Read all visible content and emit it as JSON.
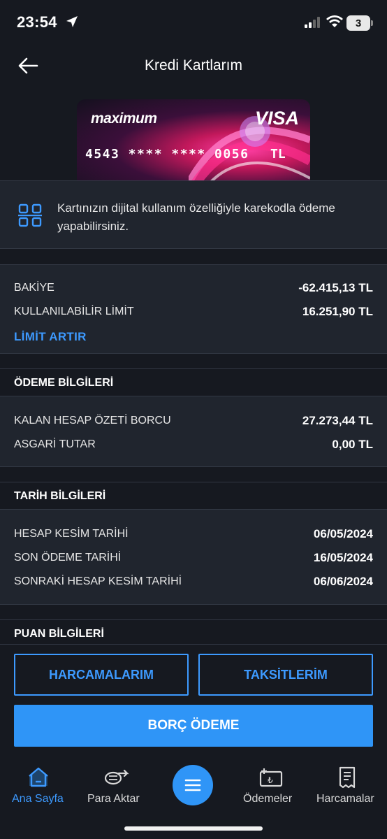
{
  "status_bar": {
    "time": "23:54",
    "battery": "3"
  },
  "header": {
    "title": "Kredi Kartlarım"
  },
  "card": {
    "brand": "maximum",
    "network": "VISA",
    "number": "4543 **** **** 0056",
    "currency": "TL"
  },
  "qr_info": {
    "text": "Kartınızın dijital kullanım özelliğiyle karekodla ödeme yapabilirsiniz."
  },
  "balance": {
    "rows": [
      {
        "label": "BAKİYE",
        "value": "-62.415,13 TL"
      },
      {
        "label": "KULLANILABİLİR LİMİT",
        "value": "16.251,90 TL"
      }
    ],
    "limit_link": "LİMİT ARTIR"
  },
  "payment_info": {
    "title": "ÖDEME BİLGİLERİ",
    "rows": [
      {
        "label": "KALAN HESAP ÖZETİ BORCU",
        "value": "27.273,44 TL"
      },
      {
        "label": "ASGARİ TUTAR",
        "value": "0,00 TL"
      }
    ]
  },
  "date_info": {
    "title": "TARİH BİLGİLERİ",
    "rows": [
      {
        "label": "HESAP KESİM TARİHİ",
        "value": "06/05/2024"
      },
      {
        "label": "SON ÖDEME TARİHİ",
        "value": "16/05/2024"
      },
      {
        "label": "SONRAKİ HESAP KESİM TARİHİ",
        "value": "06/06/2024"
      }
    ]
  },
  "points_info": {
    "title": "PUAN BİLGİLERİ"
  },
  "actions": {
    "spendings": "HARCAMALARIM",
    "installments": "TAKSİTLERİM",
    "pay_debt": "BORÇ ÖDEME"
  },
  "tabbar": {
    "items": [
      {
        "label": "Ana Sayfa",
        "icon": "home-icon",
        "active": true
      },
      {
        "label": "Para Aktar",
        "icon": "transfer-icon",
        "active": false
      },
      {
        "label": "",
        "icon": "menu-icon",
        "active": false
      },
      {
        "label": "Ödemeler",
        "icon": "payments-icon",
        "active": false
      },
      {
        "label": "Harcamalar",
        "icon": "receipt-icon",
        "active": false
      }
    ]
  },
  "colors": {
    "background": "#161920",
    "panel": "#20252e",
    "accent": "#2f95f7",
    "link": "#3d9aff"
  }
}
